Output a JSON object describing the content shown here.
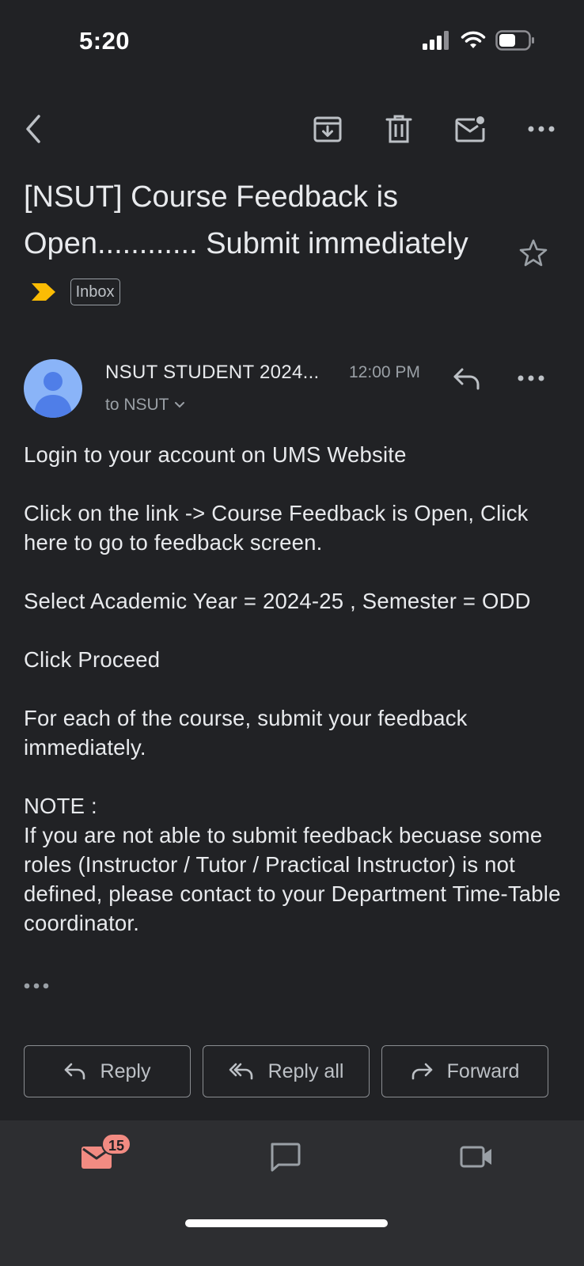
{
  "status_bar": {
    "time": "5:20"
  },
  "email": {
    "subject": "[NSUT] Course Feedback is Open............ Submit immediately",
    "label": "Inbox",
    "sender": {
      "name": "NSUT STUDENT 2024...",
      "time": "12:00 PM",
      "recipient": "to NSUT"
    },
    "body": [
      "Login to your account on UMS Website",
      "",
      "Click on the link -> Course Feedback is Open, Click here to go to feedback screen.",
      "",
      "Select Academic Year = 2024-25 , Semester = ODD",
      "",
      "Click Proceed",
      "",
      "For each of the course, submit your feedback immediately.",
      "",
      "NOTE :",
      "If you are not able to submit feedback becuase some roles (Instructor / Tutor / Practical Instructor) is not defined, please contact to your Department Time-Table coordinator."
    ]
  },
  "actions": {
    "reply": "Reply",
    "reply_all": "Reply all",
    "forward": "Forward"
  },
  "bottom_nav": {
    "mail_badge": "15"
  },
  "colors": {
    "background": "#212225",
    "nav_background": "#2d2e31",
    "avatar": "#8ab4f8",
    "importance": "#fbbc04",
    "mail_accent": "#f28b82"
  }
}
